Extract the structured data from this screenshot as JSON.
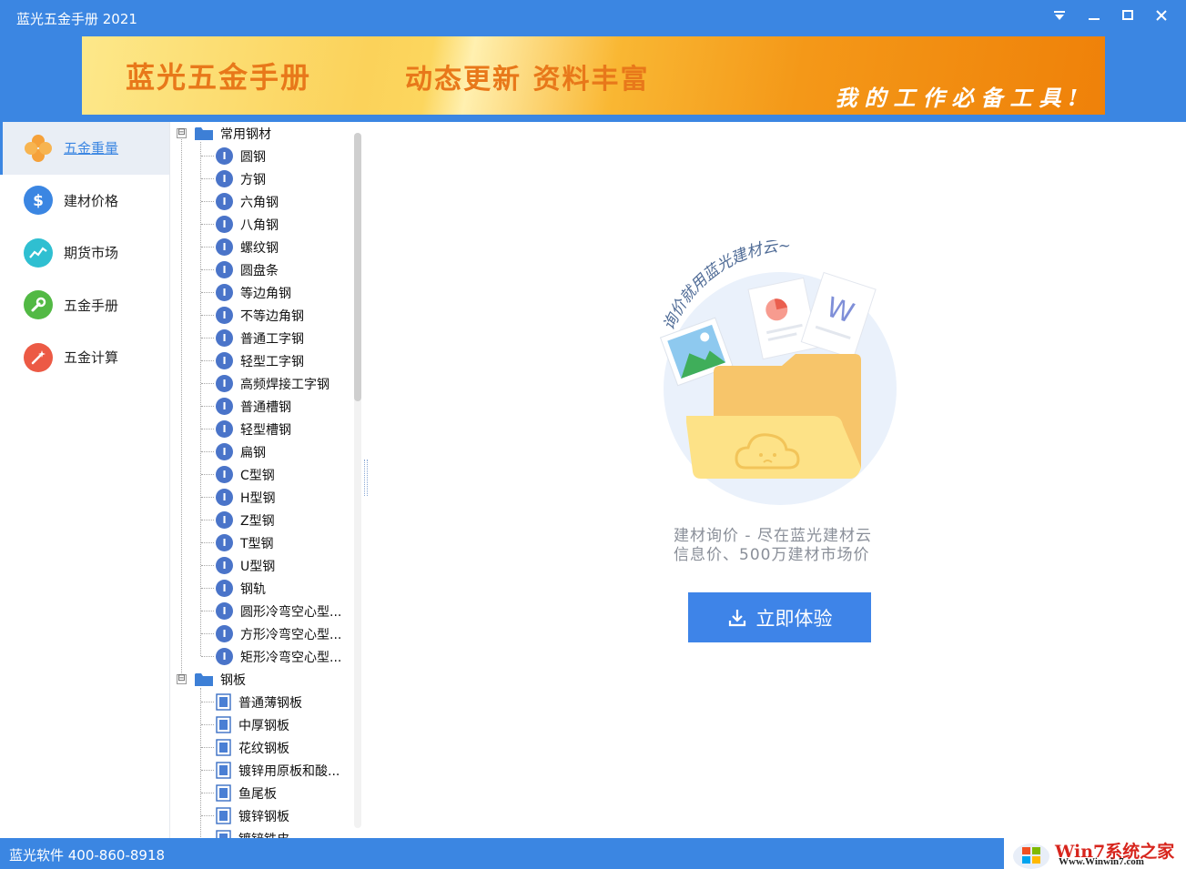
{
  "window": {
    "title": "蓝光五金手册 2021"
  },
  "banner": {
    "brand": "蓝光五金手册",
    "slogan": "动态更新 资料丰富",
    "tagline": "我的工作必备工具!"
  },
  "sidebar": {
    "items": [
      {
        "label": "五金重量",
        "icon": "clover-icon",
        "color": "#f5a13a",
        "active": true
      },
      {
        "label": "建材价格",
        "icon": "dollar-icon",
        "color": "#3b86e2",
        "active": false
      },
      {
        "label": "期货市场",
        "icon": "trend-chart-icon",
        "color": "#2fbfd1",
        "active": false
      },
      {
        "label": "五金手册",
        "icon": "wrench-icon",
        "color": "#52b944",
        "active": false
      },
      {
        "label": "五金计算",
        "icon": "magic-wand-icon",
        "color": "#ec5a45",
        "active": false
      }
    ]
  },
  "tree": {
    "groups": [
      {
        "label": "常用钢材",
        "expander": "⊟",
        "items": [
          "圆钢",
          "方钢",
          "六角钢",
          "八角钢",
          "螺纹钢",
          "圆盘条",
          "等边角钢",
          "不等边角钢",
          "普通工字钢",
          "轻型工字钢",
          "高频焊接工字钢",
          "普通槽钢",
          "轻型槽钢",
          "扁钢",
          "C型钢",
          "H型钢",
          "Z型钢",
          "T型钢",
          "U型钢",
          "钢轨",
          "圆形冷弯空心型...",
          "方形冷弯空心型...",
          "矩形冷弯空心型..."
        ]
      },
      {
        "label": "钢板",
        "expander": "⊟",
        "items": [
          "普通薄钢板",
          "中厚钢板",
          "花纹钢板",
          "镀锌用原板和酸...",
          "鱼尾板",
          "镀锌钢板",
          "镀锌铁皮"
        ]
      }
    ]
  },
  "content": {
    "illustration_caption": "询价就用蓝光建材云~",
    "promo_line1": "建材询价 - 尽在蓝光建材云",
    "promo_line2": "信息价、500万建材市场价",
    "cta_label": "立即体验"
  },
  "statusbar": {
    "text": "蓝光软件 400-860-8918"
  },
  "watermark": {
    "text": "Win7系统之家",
    "url": "Www.Winwin7.com"
  },
  "colors": {
    "accent": "#3b86e2",
    "cta": "#3e84e8",
    "banner_text": "#e8781a"
  }
}
